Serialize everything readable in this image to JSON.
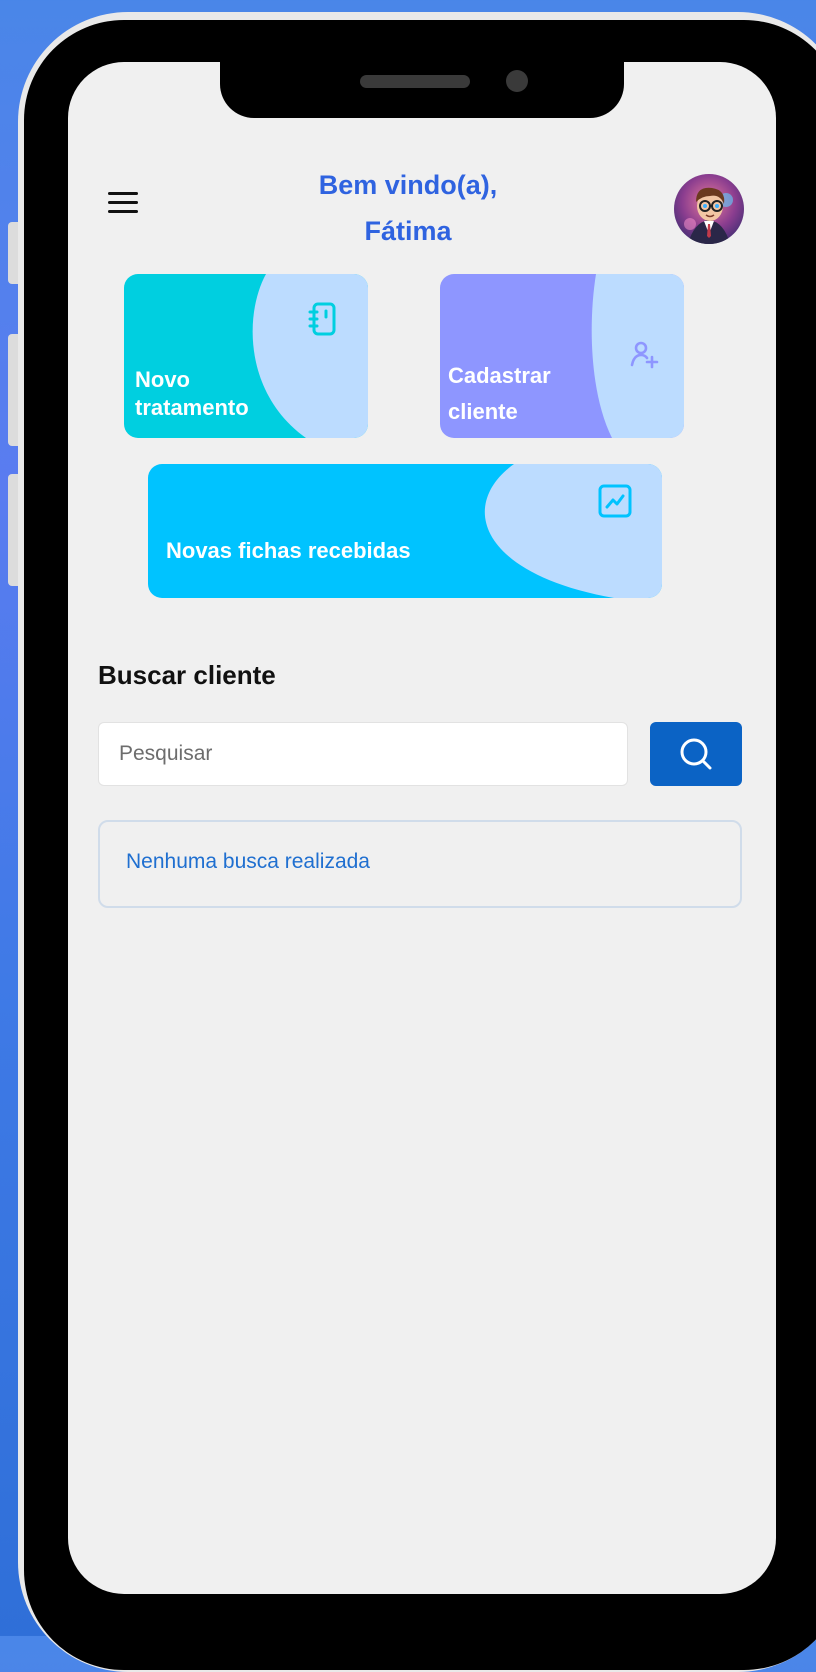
{
  "header": {
    "greeting_line1": "Bem vindo(a),",
    "greeting_line2": "Fátima"
  },
  "cards": {
    "new_treatment": {
      "line1": "Novo",
      "line2": "tratamento",
      "icon": "notebook-icon",
      "color": "#00cfe0"
    },
    "register_client": {
      "line1": "Cadastrar",
      "line2": "cliente",
      "icon": "user-plus-icon",
      "color": "#8e96ff"
    },
    "new_forms": {
      "label": "Novas fichas recebidas",
      "icon": "chart-line-icon",
      "color": "#00c3ff"
    }
  },
  "search": {
    "title": "Buscar cliente",
    "placeholder": "Pesquisar",
    "value": "",
    "button_icon": "search-icon",
    "empty_message": "Nenhuma busca realizada"
  },
  "colors": {
    "accent": "#2f63e0",
    "search_button": "#0b63c5",
    "card_blob": "#bcdcff"
  }
}
